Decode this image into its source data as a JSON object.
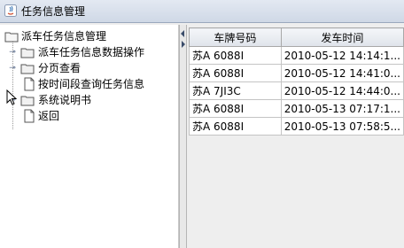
{
  "window": {
    "title": "任务信息管理"
  },
  "tree": {
    "root": "派车任务信息管理",
    "items": [
      {
        "label": "派车任务信息数据操作",
        "type": "folder",
        "expandable": true
      },
      {
        "label": "分页查看",
        "type": "folder",
        "expandable": true
      },
      {
        "label": "按时间段查询任务信息",
        "type": "file",
        "expandable": false
      },
      {
        "label": "系统说明书",
        "type": "folder",
        "expandable": true
      },
      {
        "label": "返回",
        "type": "file",
        "expandable": false
      }
    ]
  },
  "table": {
    "columns": [
      "车牌号码",
      "发车时间"
    ],
    "rows": [
      [
        "苏A 6088I",
        "2010-05-12 14:14:1..."
      ],
      [
        "苏A 6088I",
        "2010-05-12 14:41:0..."
      ],
      [
        "苏A 7JI3C",
        "2010-05-12 14:44:0..."
      ],
      [
        "苏A 6088I",
        "2010-05-13 07:17:1..."
      ],
      [
        "苏A 6088I",
        "2010-05-13 07:58:5..."
      ]
    ]
  },
  "colors": {
    "titlebar": "#cfd8e6",
    "folder": "#f1f1f1",
    "tree_toggle": "#4a5e80"
  }
}
